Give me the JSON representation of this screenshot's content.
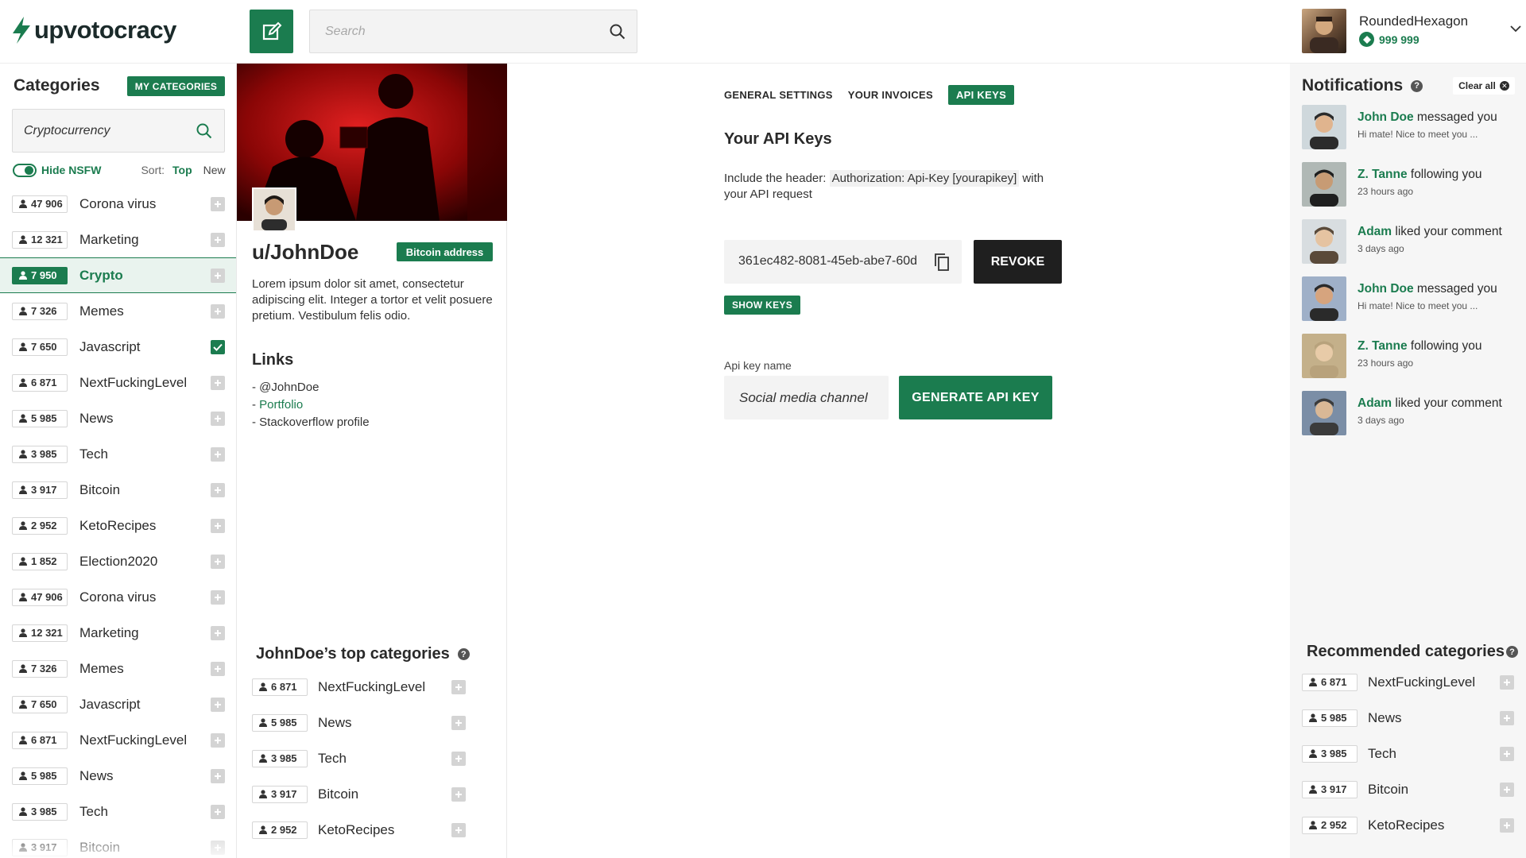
{
  "header": {
    "logo_text": "upvotocracy",
    "search_placeholder": "Search",
    "user": {
      "name": "RoundedHexagon",
      "coins": "999 999"
    }
  },
  "left_sidebar": {
    "title": "Categories",
    "my_categories_label": "MY CATEGORIES",
    "search_value": "Cryptocurrency",
    "hide_nsfw_label": "Hide NSFW",
    "sort_label": "Sort:",
    "sort_top": "Top",
    "sort_new": "New",
    "categories": [
      {
        "count": "47 906",
        "name": "Corona virus",
        "active": false,
        "checked": false
      },
      {
        "count": "12 321",
        "name": "Marketing",
        "active": false,
        "checked": false
      },
      {
        "count": "7 950",
        "name": "Crypto",
        "active": true,
        "checked": false
      },
      {
        "count": "7 326",
        "name": "Memes",
        "active": false,
        "checked": false
      },
      {
        "count": "7 650",
        "name": "Javascript",
        "active": false,
        "checked": true
      },
      {
        "count": "6 871",
        "name": "NextFuckingLevel",
        "active": false,
        "checked": false
      },
      {
        "count": "5 985",
        "name": "News",
        "active": false,
        "checked": false
      },
      {
        "count": "3 985",
        "name": "Tech",
        "active": false,
        "checked": false
      },
      {
        "count": "3 917",
        "name": "Bitcoin",
        "active": false,
        "checked": false
      },
      {
        "count": "2 952",
        "name": "KetoRecipes",
        "active": false,
        "checked": false
      },
      {
        "count": "1 852",
        "name": "Election2020",
        "active": false,
        "checked": false
      },
      {
        "count": "47 906",
        "name": "Corona virus",
        "active": false,
        "checked": false
      },
      {
        "count": "12 321",
        "name": "Marketing",
        "active": false,
        "checked": false
      },
      {
        "count": "7 326",
        "name": "Memes",
        "active": false,
        "checked": false
      },
      {
        "count": "7 650",
        "name": "Javascript",
        "active": false,
        "checked": false
      },
      {
        "count": "6 871",
        "name": "NextFuckingLevel",
        "active": false,
        "checked": false
      },
      {
        "count": "5 985",
        "name": "News",
        "active": false,
        "checked": false
      },
      {
        "count": "3 985",
        "name": "Tech",
        "active": false,
        "checked": false
      },
      {
        "count": "3 917",
        "name": "Bitcoin",
        "active": false,
        "checked": false
      }
    ]
  },
  "profile": {
    "username": "u/JohnDoe",
    "bitcoin_button": "Bitcoin address",
    "bio": "Lorem ipsum dolor sit amet, consectetur adipiscing elit. Integer a tortor et velit posuere pretium. Vestibulum felis odio.",
    "links_title": "Links",
    "links": [
      {
        "prefix": "- ",
        "text": "@JohnDoe",
        "green": false
      },
      {
        "prefix": "- ",
        "text": "Portfolio",
        "green": true
      },
      {
        "prefix": "- ",
        "text": "Stackoverflow profile",
        "green": false
      }
    ],
    "top_categories_title": "JohnDoe’s top categories",
    "top_categories": [
      {
        "count": "6 871",
        "name": "NextFuckingLevel"
      },
      {
        "count": "5 985",
        "name": "News"
      },
      {
        "count": "3 985",
        "name": "Tech"
      },
      {
        "count": "3 917",
        "name": "Bitcoin"
      },
      {
        "count": "2 952",
        "name": "KetoRecipes"
      }
    ]
  },
  "settings": {
    "tabs": [
      {
        "label": "GENERAL SETTINGS",
        "active": false
      },
      {
        "label": "YOUR INVOICES",
        "active": false
      },
      {
        "label": "API KEYS",
        "active": true
      }
    ],
    "title": "Your API Keys",
    "desc_before": "Include the header: ",
    "desc_code": "Authorization: Api-Key [yourapikey]",
    "desc_after": " with your API request",
    "api_key": "361ec482-8081-45eb-abe7-60d",
    "revoke_label": "REVOKE",
    "show_keys_label": "SHOW KEYS",
    "api_key_name_label": "Api key name",
    "api_key_name_value": "Social media channel",
    "generate_label": "GENERATE API KEY"
  },
  "notifications": {
    "title": "Notifications",
    "clear_all": "Clear all",
    "items": [
      {
        "user": "John Doe",
        "action": " messaged you",
        "detail": "Hi mate! Nice to meet you ...",
        "avatar": "a1"
      },
      {
        "user": "Z. Tanne",
        "action": " following you",
        "detail": "23 hours ago",
        "avatar": "a2"
      },
      {
        "user": "Adam",
        "action": " liked your comment",
        "detail": "3 days ago",
        "avatar": "a3"
      },
      {
        "user": "John Doe",
        "action": " messaged you",
        "detail": "Hi mate! Nice to meet you ...",
        "avatar": "a4"
      },
      {
        "user": "Z. Tanne",
        "action": " following you",
        "detail": "23 hours ago",
        "avatar": "a5"
      },
      {
        "user": "Adam",
        "action": " liked your comment",
        "detail": "3 days ago",
        "avatar": "a6"
      }
    ]
  },
  "recommended": {
    "title": "Recommended categories",
    "items": [
      {
        "count": "6 871",
        "name": "NextFuckingLevel"
      },
      {
        "count": "5 985",
        "name": "News"
      },
      {
        "count": "3 985",
        "name": "Tech"
      },
      {
        "count": "3 917",
        "name": "Bitcoin"
      },
      {
        "count": "2 952",
        "name": "KetoRecipes"
      }
    ]
  },
  "colors": {
    "accent": "#1b7c4f",
    "dark": "#1f1f1f",
    "muted_box": "#d4d4d4"
  }
}
